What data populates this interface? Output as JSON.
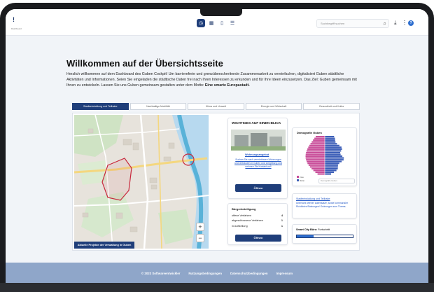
{
  "header": {
    "logo_mark": "!",
    "logo_caption": "Dashboard",
    "nav": [
      {
        "icon": "dashboard-icon",
        "glyph": "◷",
        "active": true
      },
      {
        "icon": "grid-icon",
        "glyph": "▦",
        "active": false
      },
      {
        "icon": "map-icon",
        "glyph": "▯",
        "active": false
      },
      {
        "icon": "list-icon",
        "glyph": "☰",
        "active": false
      }
    ],
    "search_placeholder": "Suchbegriff suchen",
    "help_glyph": "?"
  },
  "main": {
    "title": "Willkommen auf der Übersichtsseite",
    "intro_lead": "Herzlich willkommen auf dem Dashboard des Guben Cockpit! Um barrierefreie und grenzüberschreitende Zusammenarbeit zu vereinfachen, digitalisiert Guben städtliche Aktivitäten und Informationen. Seien Sie eingeladen die städtische Daten frei nach Ihren Interessen  zu erkunden und für Ihre Ideen einzusetzen. Das Ziel: Guben gemeinsam mit Ihnen zu entwickeln. Lassen Sie uns Guben gemeinsam gestalten unter dem Motto: ",
    "intro_motto": "Eine smarte Europastadt.",
    "tabs": [
      "Stadtentwicklung und Teilhabe",
      "Nachhaltige Mobilität",
      "Klima und Umwelt",
      "Energie und Wirtschaft",
      "Gesundheit und Kultur"
    ]
  },
  "map": {
    "label": "Aktuelle Projekte der Verwaltung in Guben",
    "zoom_in": "+",
    "zoom_out": "−"
  },
  "important": {
    "title": "WICHTIGES AUF EINEN BLICK",
    "housing_link": "Wohnungsangebot",
    "housing_text": "Suchen Sie nach vermietbaren Wohnungen und Gebäuden in Guben und Umgebung und nehmen Sie Kontakt auf!",
    "open": "Öffnen"
  },
  "participation": {
    "title": "Bürgerbeteiligung",
    "rows": [
      {
        "label": "offene Verfahren",
        "value": "4"
      },
      {
        "label": "abgeschlossene Verfahren",
        "value": "1"
      },
      {
        "label": "in Aufstellung",
        "value": "1"
      }
    ],
    "open": "Öffnen"
  },
  "demography": {
    "title": "Demografie Guben",
    "legend": [
      "Frau",
      "Mann"
    ],
    "more": "Demografie Guben"
  },
  "urban": {
    "link": "Stadtentwicklung und Teilhabe",
    "text": "Übersicht offener Datensätze, sowie kommunaler Richtlinien/Satzungen/ Ordnungen zum Thema."
  },
  "smartcity": {
    "title": "Smart City Büro:",
    "status": "Fortschritt",
    "progress": 0.3
  },
  "colors": {
    "primary": "#1f3e7a",
    "female": "#c94f9a",
    "male": "#3d5fb8",
    "footer": "#8fa6c9"
  },
  "footer": {
    "links": [
      "© 2023 Softwareentwickler",
      "Nutzungsbedingungen",
      "Datenschutzbedingungen",
      "Impressum"
    ]
  }
}
